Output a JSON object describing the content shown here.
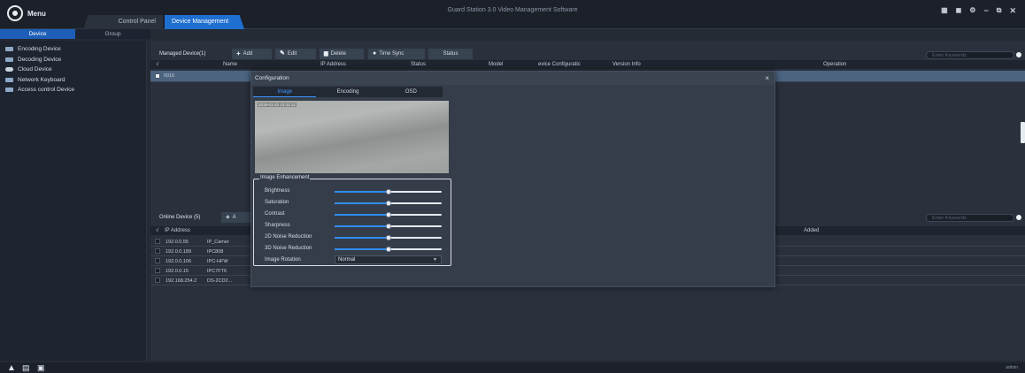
{
  "app": {
    "title": "Guard Station 3.0 Video Management Software",
    "menu_label": "Menu",
    "top_tabs": [
      "Control Panel",
      "Device Management"
    ],
    "window_controls": [
      "⊞",
      "🔒",
      "⚙",
      "−",
      "⧉",
      "✕"
    ]
  },
  "sub_tabs": [
    "Device",
    "Group"
  ],
  "sidebar": {
    "items": [
      {
        "label": "Encoding Device",
        "icon": "encoder-icon"
      },
      {
        "label": "Decoding Device",
        "icon": "decoder-icon"
      },
      {
        "label": "Cloud Device",
        "icon": "cloud-icon"
      },
      {
        "label": "Network Keyboard",
        "icon": "keyboard-icon"
      },
      {
        "label": "Access control Device",
        "icon": "access-control-icon"
      }
    ]
  },
  "managed": {
    "title": "Managed Device(1)",
    "buttons": {
      "add": "Add",
      "edit": "Edit",
      "delete": "Delete",
      "time_sync": "Time Sync",
      "status": "Status"
    },
    "search_placeholder": "Enter Keywords",
    "columns": {
      "name": "Name",
      "ip": "IP Address",
      "status": "Status",
      "model": "Model",
      "config": "evice Configuratic",
      "version": "Version Info",
      "operation": "Operation"
    },
    "rows": [
      {
        "name": "0016",
        "checked": true
      }
    ]
  },
  "online": {
    "title": "Online Device (5)",
    "add_label": "A",
    "search_placeholder": "Enter Keywords",
    "columns": {
      "ip": "IP Address",
      "added": "Added"
    },
    "rows": [
      {
        "ip": "192.0.0.55",
        "model": "IP_Camer"
      },
      {
        "ip": "192.0.0.189",
        "model": "IPC808"
      },
      {
        "ip": "192.0.0.106",
        "model": "IPC-HFW"
      },
      {
        "ip": "192.0.0.15",
        "model": "IPC7FT6"
      },
      {
        "ip": "192.168.254.2",
        "model": "DS-2CD2..."
      }
    ]
  },
  "dialog": {
    "title": "Configuration",
    "close": "×",
    "tabs": [
      "Image",
      "Encoding",
      "OSD"
    ],
    "preview_stamp": "2019-01-10 13:41:12",
    "enhancement_title": "Image Enhancement",
    "sliders": [
      {
        "label": "Brightness",
        "value": 50
      },
      {
        "label": "Saturation",
        "value": 50
      },
      {
        "label": "Contrast",
        "value": 50
      },
      {
        "label": "Sharpness",
        "value": 50
      },
      {
        "label": "2D Noise Reduction",
        "value": 50
      },
      {
        "label": "3D Noise Reduction",
        "value": 50
      }
    ],
    "rotation": {
      "label": "Image Rotation",
      "value": "Normal"
    }
  },
  "statusbar": {
    "icons": [
      "alarm-icon",
      "document-icon",
      "record-icon"
    ],
    "user": "admin"
  }
}
